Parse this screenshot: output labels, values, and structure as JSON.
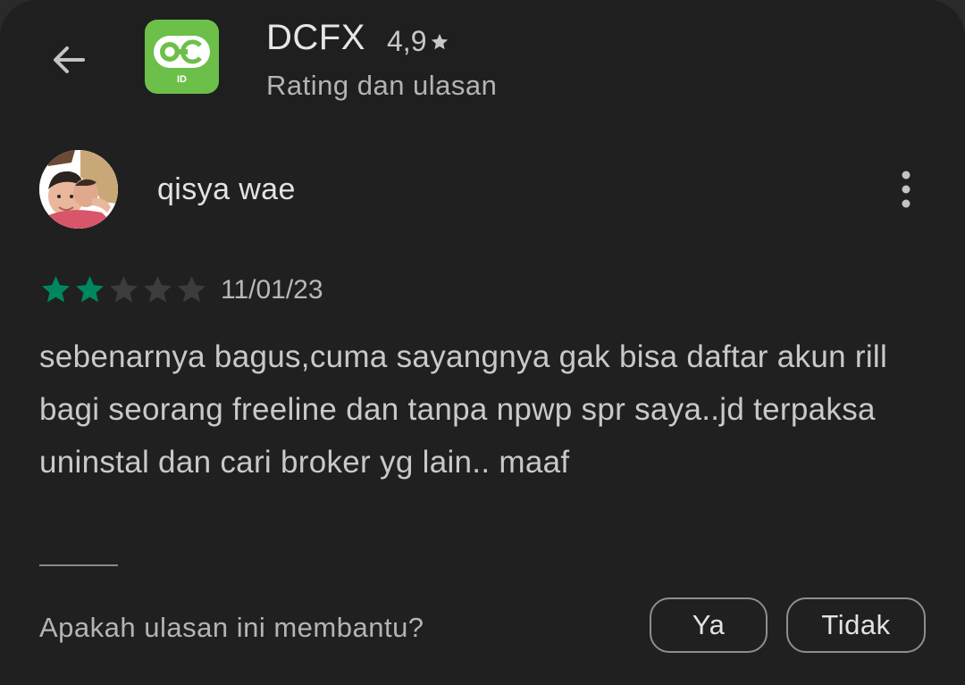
{
  "header": {
    "app_name": "DCFX",
    "rating": "4,9",
    "subtitle": "Rating dan ulasan",
    "app_icon_text": "ID"
  },
  "review": {
    "author": "qisya wae",
    "stars_filled": 2,
    "stars_total": 5,
    "date": "11/01/23",
    "text": "sebenarnya bagus,cuma sayangnya gak bisa daftar akun rill bagi seorang freeline dan tanpa npwp spr saya..jd terpaksa uninstal dan cari broker yg lain.. maaf"
  },
  "feedback": {
    "question": "Apakah ulasan ini membantu?",
    "yes_label": "Ya",
    "no_label": "Tidak"
  },
  "icons": {
    "back": "arrow-back-icon",
    "more": "more-vert-icon",
    "star": "star-icon"
  },
  "colors": {
    "background": "#202020",
    "star_filled": "#01875f",
    "star_empty": "#3c3c3c",
    "app_icon_bg": "#6cc04a"
  }
}
